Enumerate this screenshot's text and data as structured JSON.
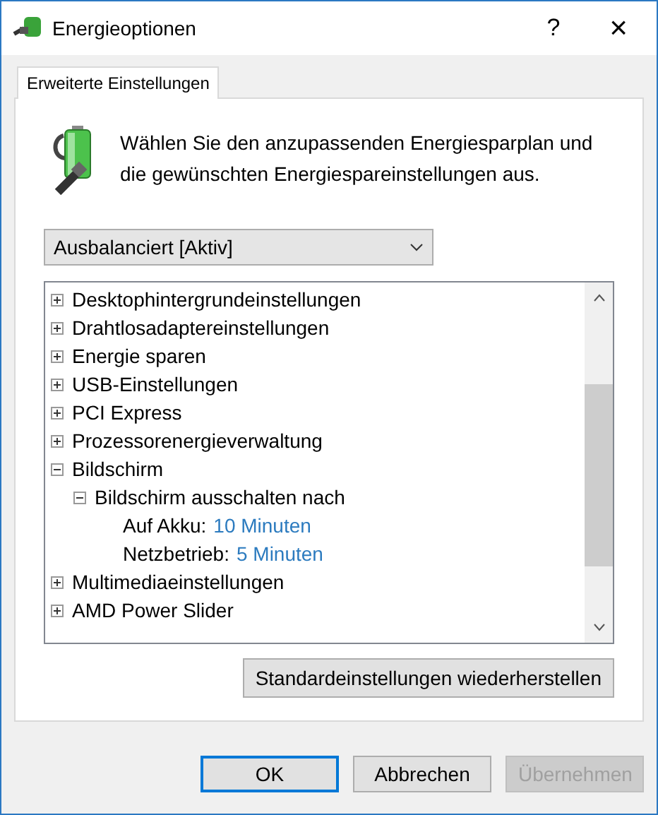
{
  "window": {
    "title": "Energieoptionen",
    "help": "?",
    "close": "×"
  },
  "tabs": [
    {
      "label": "Erweiterte Einstellungen",
      "selected": true
    }
  ],
  "intro": "Wählen Sie den anzupassenden Energiesparplan und die gewünschten Energiespareinstellungen aus.",
  "plan_dropdown": {
    "value": "Ausbalanciert [Aktiv]"
  },
  "tree": [
    {
      "kind": "group",
      "label": "Desktophintergrundeinstellungen",
      "expanded": false
    },
    {
      "kind": "group",
      "label": "Drahtlosadaptereinstellungen",
      "expanded": false
    },
    {
      "kind": "group",
      "label": "Energie sparen",
      "expanded": false
    },
    {
      "kind": "group",
      "label": "USB-Einstellungen",
      "expanded": false
    },
    {
      "kind": "group",
      "label": "PCI Express",
      "expanded": false
    },
    {
      "kind": "group",
      "label": "Prozessorenergieverwaltung",
      "expanded": false
    },
    {
      "kind": "group",
      "label": "Bildschirm",
      "expanded": true,
      "children": [
        {
          "kind": "group",
          "label": "Bildschirm ausschalten nach",
          "expanded": true,
          "children": [
            {
              "kind": "setting",
              "label": "Auf Akku:",
              "value": "10 Minuten"
            },
            {
              "kind": "setting",
              "label": "Netzbetrieb:",
              "value": "5 Minuten"
            }
          ]
        }
      ]
    },
    {
      "kind": "group",
      "label": "Multimediaeinstellungen",
      "expanded": false
    },
    {
      "kind": "group",
      "label": "AMD Power Slider",
      "expanded": false
    }
  ],
  "restore_button": "Standardeinstellungen wiederherstellen",
  "buttons": [
    {
      "label": "OK",
      "default": true,
      "disabled": false
    },
    {
      "label": "Abbrechen",
      "default": false,
      "disabled": false
    },
    {
      "label": "Übernehmen",
      "default": false,
      "disabled": true
    }
  ]
}
